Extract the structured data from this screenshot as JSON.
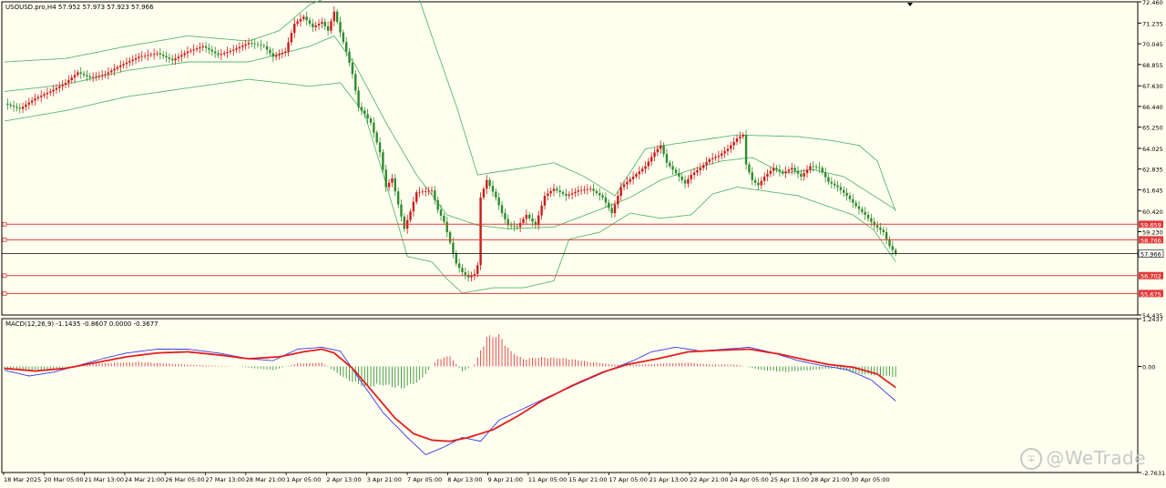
{
  "colors": {
    "background": "#fffff0",
    "bull": "#cc1b1b",
    "bear": "#2f8a2f",
    "bands": "#58b870",
    "level_line": "#e33b3b",
    "current_line": "#000000",
    "macd_line": "#3a3ae0",
    "signal_line": "#e51c1c",
    "hist_pos": "#e05050",
    "hist_neg": "#4a9e4a",
    "axis_text": "#000000"
  },
  "header": {
    "symbol_info": "USOUSD.pro,H4  57.952 57.973 57.923 57.966",
    "macd_info": "MACD(12,26,9) -1.1435 -0.8607 0.0000 -0.3677"
  },
  "watermark": {
    "text": "@WeTrade",
    "logo_icon": "wetrade-logo-icon"
  },
  "chart_data": [
    {
      "type": "candlestick",
      "title": "USOUSD.pro,H4",
      "ohlc_header": [
        57.952,
        57.973,
        57.923,
        57.966
      ],
      "ylim": [
        54.435,
        72.46
      ],
      "y_ticks": [
        "72.460",
        "71.235",
        "70.045",
        "68.855",
        "67.630",
        "66.440",
        "65.250",
        "64.025",
        "62.835",
        "61.645",
        "60.420",
        "59.230",
        "54.435"
      ],
      "x_ticks": [
        "18 Mar 2025",
        "20 Mar 05:00",
        "21 Mar 13:00",
        "24 Mar 21:00",
        "26 Mar 05:00",
        "27 Mar 13:00",
        "28 Mar 21:00",
        "1 Apr 05:00",
        "2 Apr 13:00",
        "3 Apr 21:00",
        "7 Apr 05:00",
        "8 Apr 13:00",
        "9 Apr 21:00",
        "11 Apr 05:00",
        "15 Apr 21:00",
        "17 Apr 05:00",
        "21 Apr 13:00",
        "22 Apr 21:00",
        "24 Apr 05:00",
        "25 Apr 13:00",
        "28 Apr 21:00",
        "30 Apr 05:00"
      ],
      "levels": [
        {
          "label": "59.659",
          "value": 59.659
        },
        {
          "label": "58.766",
          "value": 58.766
        },
        {
          "label": "56.702",
          "value": 56.702
        },
        {
          "label": "55.675",
          "value": 55.675
        }
      ],
      "current_price": {
        "label": "57.966",
        "value": 57.966
      },
      "close_path": [
        [
          0,
          66.6
        ],
        [
          5,
          66.3
        ],
        [
          10,
          66.9
        ],
        [
          15,
          67.3
        ],
        [
          20,
          67.8
        ],
        [
          24,
          68.4
        ],
        [
          28,
          68.1
        ],
        [
          33,
          68.3
        ],
        [
          38,
          68.8
        ],
        [
          44,
          69.3
        ],
        [
          50,
          69.5
        ],
        [
          55,
          69.1
        ],
        [
          60,
          69.6
        ],
        [
          65,
          69.9
        ],
        [
          70,
          69.4
        ],
        [
          75,
          69.7
        ],
        [
          80,
          70.1
        ],
        [
          85,
          69.9
        ],
        [
          88,
          69.3
        ],
        [
          92,
          69.6
        ],
        [
          95,
          71.2
        ],
        [
          98,
          71.6
        ],
        [
          101,
          71.0
        ],
        [
          104,
          71.3
        ],
        [
          106,
          70.8
        ],
        [
          108,
          71.9
        ],
        [
          110,
          70.7
        ],
        [
          112,
          69.6
        ],
        [
          114,
          68.3
        ],
        [
          116,
          66.4
        ],
        [
          118,
          66.0
        ],
        [
          120,
          65.5
        ],
        [
          123,
          63.8
        ],
        [
          125,
          61.8
        ],
        [
          127,
          62.3
        ],
        [
          129,
          60.8
        ],
        [
          131,
          59.4
        ],
        [
          133,
          60.4
        ],
        [
          135,
          61.5
        ],
        [
          140,
          61.6
        ],
        [
          142,
          60.5
        ],
        [
          144,
          59.8
        ],
        [
          146,
          58.6
        ],
        [
          148,
          57.4
        ],
        [
          150,
          56.9
        ],
        [
          152,
          56.6
        ],
        [
          154,
          56.8
        ],
        [
          155,
          57.3
        ],
        [
          156,
          61.2
        ],
        [
          158,
          62.2
        ],
        [
          161,
          61.2
        ],
        [
          163,
          60.3
        ],
        [
          165,
          59.6
        ],
        [
          168,
          59.5
        ],
        [
          171,
          60.2
        ],
        [
          174,
          59.6
        ],
        [
          177,
          61.3
        ],
        [
          180,
          61.7
        ],
        [
          184,
          61.3
        ],
        [
          188,
          61.6
        ],
        [
          192,
          61.7
        ],
        [
          196,
          61.2
        ],
        [
          199,
          60.3
        ],
        [
          202,
          61.8
        ],
        [
          206,
          62.4
        ],
        [
          210,
          63.0
        ],
        [
          213,
          63.8
        ],
        [
          215,
          64.2
        ],
        [
          217,
          63.2
        ],
        [
          220,
          62.6
        ],
        [
          223,
          62.0
        ],
        [
          225,
          62.5
        ],
        [
          228,
          62.9
        ],
        [
          231,
          63.4
        ],
        [
          234,
          63.6
        ],
        [
          237,
          64.0
        ],
        [
          240,
          64.6
        ],
        [
          242,
          64.8
        ],
        [
          243,
          63.1
        ],
        [
          245,
          62.2
        ],
        [
          247,
          61.9
        ],
        [
          249,
          62.4
        ],
        [
          252,
          62.9
        ],
        [
          255,
          62.6
        ],
        [
          258,
          62.9
        ],
        [
          261,
          62.4
        ],
        [
          264,
          63.0
        ],
        [
          267,
          62.9
        ],
        [
          270,
          62.1
        ],
        [
          273,
          61.8
        ],
        [
          276,
          61.3
        ],
        [
          279,
          60.7
        ],
        [
          282,
          60.2
        ],
        [
          285,
          59.6
        ],
        [
          288,
          59.2
        ],
        [
          290,
          58.4
        ],
        [
          292,
          57.95
        ]
      ],
      "bollinger_upper": [
        [
          0,
          69.0
        ],
        [
          20,
          69.2
        ],
        [
          40,
          69.9
        ],
        [
          60,
          70.5
        ],
        [
          80,
          70.2
        ],
        [
          90,
          70.8
        ],
        [
          100,
          72.3
        ],
        [
          110,
          73.0
        ],
        [
          120,
          73.5
        ],
        [
          134,
          73.6
        ],
        [
          140,
          70.5
        ],
        [
          148,
          66.5
        ],
        [
          155,
          62.5
        ],
        [
          170,
          62.9
        ],
        [
          180,
          63.2
        ],
        [
          190,
          62.4
        ],
        [
          200,
          61.3
        ],
        [
          210,
          64.0
        ],
        [
          220,
          64.3
        ],
        [
          240,
          64.8
        ],
        [
          260,
          64.7
        ],
        [
          270,
          64.5
        ],
        [
          280,
          64.2
        ],
        [
          286,
          63.3
        ],
        [
          292,
          60.4
        ]
      ],
      "bollinger_middle": [
        [
          0,
          67.3
        ],
        [
          20,
          67.7
        ],
        [
          40,
          68.5
        ],
        [
          60,
          69.0
        ],
        [
          80,
          69.0
        ],
        [
          100,
          69.9
        ],
        [
          108,
          70.5
        ],
        [
          115,
          68.8
        ],
        [
          125,
          65.5
        ],
        [
          135,
          62.5
        ],
        [
          145,
          60.2
        ],
        [
          155,
          59.6
        ],
        [
          165,
          59.4
        ],
        [
          180,
          59.5
        ],
        [
          195,
          60.5
        ],
        [
          205,
          61.2
        ],
        [
          215,
          62.2
        ],
        [
          225,
          62.8
        ],
        [
          235,
          63.3
        ],
        [
          245,
          63.5
        ],
        [
          255,
          62.6
        ],
        [
          265,
          62.8
        ],
        [
          275,
          62.4
        ],
        [
          292,
          60.5
        ]
      ],
      "bollinger_lower": [
        [
          0,
          65.6
        ],
        [
          20,
          66.2
        ],
        [
          40,
          67.0
        ],
        [
          60,
          67.5
        ],
        [
          80,
          68.0
        ],
        [
          90,
          67.8
        ],
        [
          100,
          67.6
        ],
        [
          110,
          67.8
        ],
        [
          118,
          66.0
        ],
        [
          125,
          62.0
        ],
        [
          132,
          57.8
        ],
        [
          140,
          57.5
        ],
        [
          145,
          56.5
        ],
        [
          150,
          55.7
        ],
        [
          160,
          56.0
        ],
        [
          170,
          56.0
        ],
        [
          180,
          56.4
        ],
        [
          185,
          58.8
        ],
        [
          195,
          59.2
        ],
        [
          205,
          60.3
        ],
        [
          215,
          60.0
        ],
        [
          225,
          60.2
        ],
        [
          232,
          61.4
        ],
        [
          240,
          61.8
        ],
        [
          248,
          61.6
        ],
        [
          260,
          61.3
        ],
        [
          268,
          60.8
        ],
        [
          278,
          60.2
        ],
        [
          285,
          59.3
        ],
        [
          292,
          57.5
        ]
      ]
    },
    {
      "type": "line",
      "title": "MACD(12,26,9)",
      "header_values": [
        -1.1435,
        -0.8607,
        0.0,
        -0.3677
      ],
      "ylim": [
        -2.7631,
        1.2437
      ],
      "y_ticks": [
        "1.2437",
        "0.00",
        "-2.7631"
      ],
      "series": [
        {
          "name": "MACD",
          "points": [
            [
              0,
              -0.1
            ],
            [
              8,
              -0.25
            ],
            [
              16,
              -0.15
            ],
            [
              24,
              0.02
            ],
            [
              32,
              0.2
            ],
            [
              40,
              0.35
            ],
            [
              50,
              0.45
            ],
            [
              60,
              0.45
            ],
            [
              70,
              0.35
            ],
            [
              80,
              0.2
            ],
            [
              88,
              0.15
            ],
            [
              96,
              0.45
            ],
            [
              104,
              0.5
            ],
            [
              110,
              0.4
            ],
            [
              116,
              -0.3
            ],
            [
              124,
              -1.2
            ],
            [
              132,
              -1.85
            ],
            [
              138,
              -2.3
            ],
            [
              144,
              -2.1
            ],
            [
              150,
              -1.85
            ],
            [
              156,
              -1.95
            ],
            [
              162,
              -1.4
            ],
            [
              170,
              -1.1
            ],
            [
              178,
              -0.8
            ],
            [
              188,
              -0.45
            ],
            [
              198,
              -0.1
            ],
            [
              206,
              0.15
            ],
            [
              212,
              0.38
            ],
            [
              220,
              0.5
            ],
            [
              228,
              0.4
            ],
            [
              236,
              0.45
            ],
            [
              244,
              0.5
            ],
            [
              252,
              0.35
            ],
            [
              260,
              0.15
            ],
            [
              268,
              0.02
            ],
            [
              276,
              -0.08
            ],
            [
              284,
              -0.35
            ],
            [
              292,
              -0.9
            ]
          ]
        },
        {
          "name": "Signal",
          "points": [
            [
              0,
              -0.05
            ],
            [
              10,
              -0.12
            ],
            [
              20,
              -0.05
            ],
            [
              30,
              0.1
            ],
            [
              40,
              0.25
            ],
            [
              50,
              0.35
            ],
            [
              60,
              0.38
            ],
            [
              70,
              0.3
            ],
            [
              80,
              0.2
            ],
            [
              90,
              0.25
            ],
            [
              98,
              0.38
            ],
            [
              104,
              0.45
            ],
            [
              108,
              0.35
            ],
            [
              114,
              -0.05
            ],
            [
              120,
              -0.6
            ],
            [
              128,
              -1.35
            ],
            [
              134,
              -1.75
            ],
            [
              140,
              -1.92
            ],
            [
              146,
              -1.95
            ],
            [
              152,
              -1.85
            ],
            [
              160,
              -1.65
            ],
            [
              168,
              -1.3
            ],
            [
              176,
              -0.9
            ],
            [
              186,
              -0.5
            ],
            [
              196,
              -0.15
            ],
            [
              204,
              0.05
            ],
            [
              214,
              0.2
            ],
            [
              224,
              0.38
            ],
            [
              234,
              0.42
            ],
            [
              244,
              0.45
            ],
            [
              254,
              0.32
            ],
            [
              262,
              0.18
            ],
            [
              270,
              0.05
            ],
            [
              278,
              -0.02
            ],
            [
              286,
              -0.2
            ],
            [
              292,
              -0.55
            ]
          ]
        },
        {
          "name": "Histogram",
          "points": [
            [
              0,
              -0.1
            ],
            [
              16,
              -0.08
            ],
            [
              30,
              0.08
            ],
            [
              44,
              0.12
            ],
            [
              60,
              0.05
            ],
            [
              76,
              0.0
            ],
            [
              88,
              -0.1
            ],
            [
              96,
              0.08
            ],
            [
              104,
              0.1
            ],
            [
              112,
              -0.35
            ],
            [
              118,
              -0.55
            ],
            [
              124,
              -0.5
            ],
            [
              130,
              -0.6
            ],
            [
              136,
              -0.4
            ],
            [
              142,
              0.2
            ],
            [
              146,
              0.28
            ],
            [
              150,
              -0.15
            ],
            [
              154,
              0.05
            ],
            [
              158,
              0.8
            ],
            [
              162,
              0.85
            ],
            [
              166,
              0.4
            ],
            [
              170,
              0.2
            ],
            [
              176,
              0.25
            ],
            [
              184,
              0.22
            ],
            [
              192,
              0.12
            ],
            [
              200,
              0.05
            ],
            [
              208,
              0.05
            ],
            [
              216,
              0.08
            ],
            [
              224,
              0.1
            ],
            [
              232,
              0.05
            ],
            [
              240,
              0.05
            ],
            [
              248,
              -0.1
            ],
            [
              256,
              -0.15
            ],
            [
              264,
              -0.1
            ],
            [
              272,
              -0.05
            ],
            [
              280,
              -0.2
            ],
            [
              286,
              -0.25
            ],
            [
              292,
              -0.28
            ]
          ]
        }
      ]
    }
  ]
}
